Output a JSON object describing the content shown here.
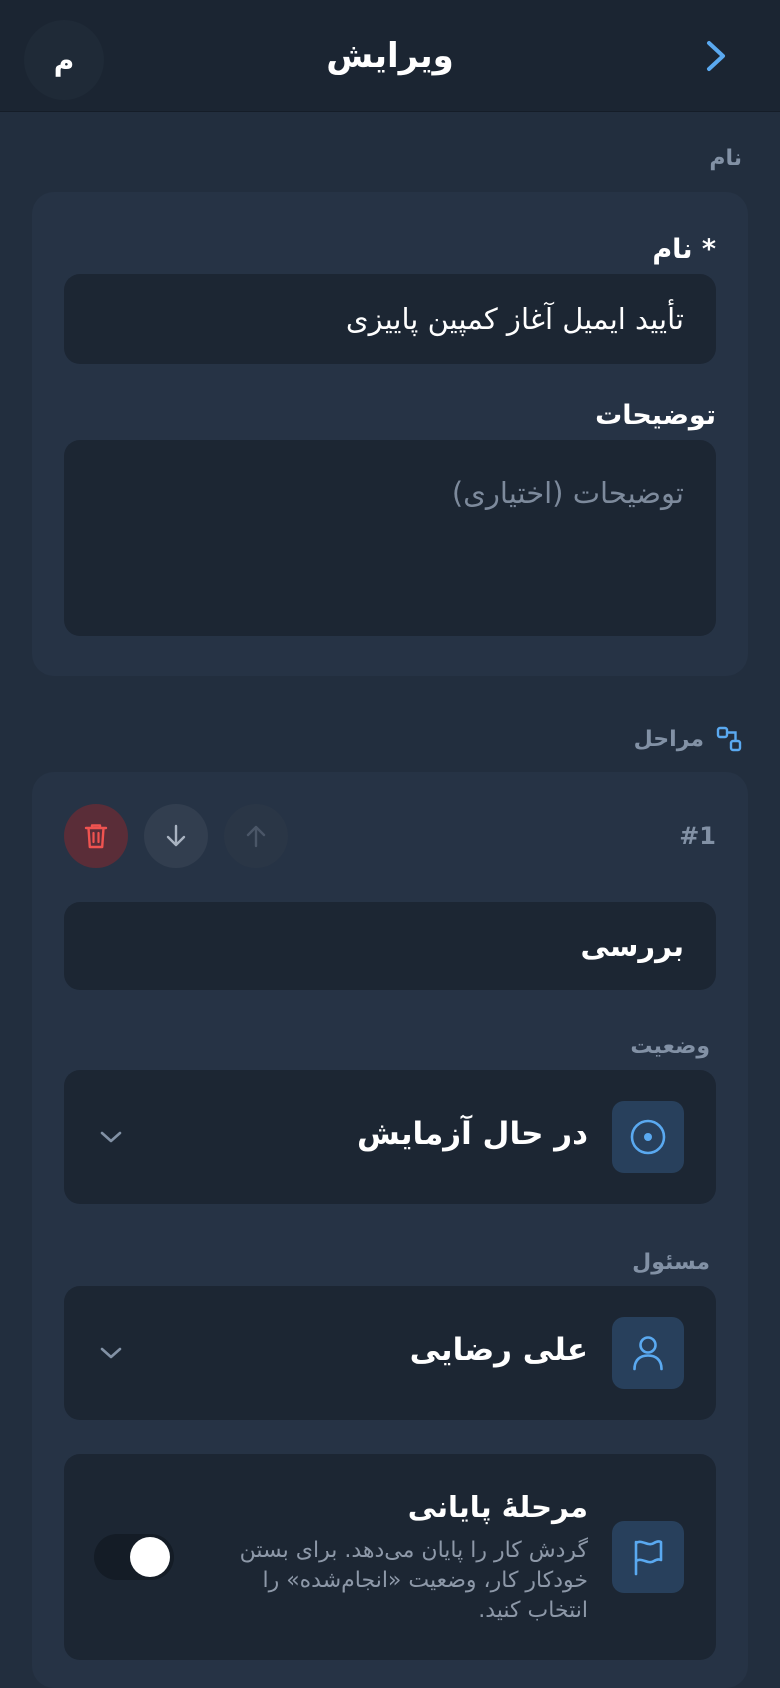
{
  "header": {
    "avatar_letter": "م",
    "title": "ویرایش"
  },
  "name_section": {
    "label": "نام",
    "name_field_label": "نام *",
    "name_value": "تأیید ایمیل آغاز کمپین پاییزی",
    "description_label": "توضیحات",
    "description_placeholder": "توضیحات (اختیاری)"
  },
  "steps_section": {
    "label": "مراحل",
    "step": {
      "number": "#1",
      "name_value": "بررسی",
      "status_label": "وضعیت",
      "status_value": "در حال آزمایش",
      "assignee_label": "مسئول",
      "assignee_value": "علی رضایی",
      "final_title": "مرحلهٔ پایانی",
      "final_description": "گردش کار را پایان می‌دهد. برای بستن خودکار کار، وضعیت «انجام‌شده» را انتخاب کنید.",
      "final_enabled": true
    }
  },
  "colors": {
    "accent": "#5aa9f0",
    "danger": "#ef5350",
    "background": "#222e3e",
    "card": "#263345",
    "input": "#1c2633"
  },
  "icons": {
    "back": "chevron-right-icon",
    "steps": "flow-icon",
    "delete": "trash-icon",
    "move_down": "arrow-down-icon",
    "move_up": "arrow-up-icon",
    "status": "target-icon",
    "assignee": "user-icon",
    "final": "flag-icon",
    "dropdown": "chevron-down-icon"
  }
}
